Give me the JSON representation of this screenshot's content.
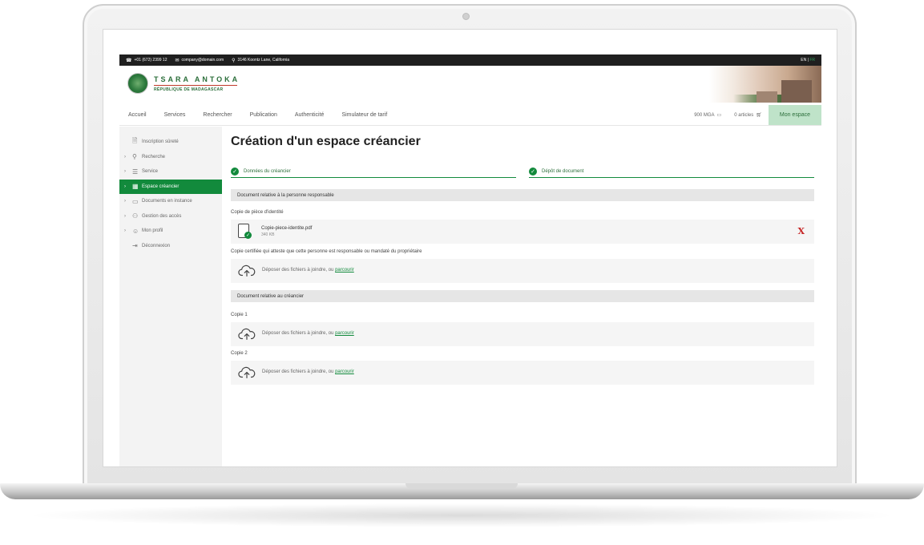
{
  "topbar": {
    "phone": "+01 (672) 2399 12",
    "email": "company@domain.com",
    "address": "3146 Koontz Lane, California",
    "lang_active": "EN",
    "lang_separator": "|",
    "lang_other": "FR"
  },
  "brand": {
    "title": "TSARA ANTOKA",
    "subtitle": "RÉPUBLIQUE DE MADAGASCAR"
  },
  "nav": {
    "items": [
      "Accueil",
      "Services",
      "Rechercher",
      "Publication",
      "Authenticité",
      "Simulateur de tarif"
    ],
    "balance": "900 MGA",
    "cart": "0 articles",
    "account_button": "Mon espace"
  },
  "sidebar": {
    "items": [
      {
        "label": "Inscription sûreté",
        "icon": "document-icon",
        "has_chevron": false
      },
      {
        "label": "Recherche",
        "icon": "search-icon",
        "has_chevron": true
      },
      {
        "label": "Service",
        "icon": "list-icon",
        "has_chevron": true
      },
      {
        "label": "Espace créancier",
        "icon": "building-icon",
        "has_chevron": true,
        "active": true
      },
      {
        "label": "Documents en instance",
        "icon": "folder-icon",
        "has_chevron": true
      },
      {
        "label": "Gestion des accès",
        "icon": "users-icon",
        "has_chevron": true
      },
      {
        "label": "Mon profil",
        "icon": "profile-icon",
        "has_chevron": true
      },
      {
        "label": "Déconnexion",
        "icon": "logout-icon",
        "has_chevron": false
      }
    ]
  },
  "page": {
    "title": "Création d'un espace créancier",
    "steps": [
      {
        "label": "Données du créancier",
        "done": true
      },
      {
        "label": "Dépôt de document",
        "done": true
      }
    ],
    "section1": {
      "heading": "Document relative à la personne responsable",
      "field1_label": "Copie de pièce d'identité",
      "file_name": "Copie-piece-identite.pdf",
      "file_size": "340 KB",
      "field2_label": "Copie certifiée qui atteste que cette personne est responsable ou mandaté du propriétaire"
    },
    "section2": {
      "heading": "Document relative au créancier",
      "field1_label": "Copie 1",
      "field2_label": "Copie 2"
    },
    "dropzone": {
      "text": "Déposer des fichiers à joindre, ou",
      "link": "parcourir"
    }
  },
  "colors": {
    "accent": "#128a3c",
    "accent_light": "#bfe3c9",
    "danger": "#c62828",
    "topbar": "#1f1f1f"
  }
}
